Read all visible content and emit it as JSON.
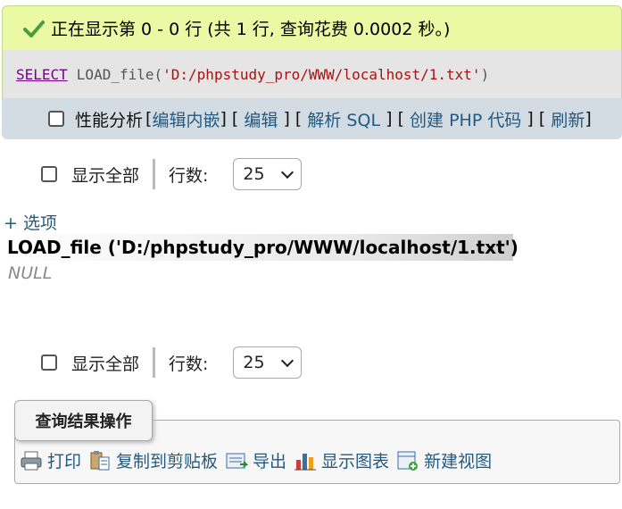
{
  "result_message": "正在显示第 0 - 0 行 (共 1 行, 查询花费 0.0002 秒。)",
  "sql": {
    "keyword": "SELECT",
    "function": "LOAD_file",
    "open": " (",
    "string": "'D:/phpstudy_pro/WWW/localhost/1.txt'",
    "close": ")"
  },
  "tools": {
    "profiling_label": "性能分析",
    "edit_inline": "编辑内嵌",
    "edit": "编辑",
    "explain_sql": "解析 SQL",
    "create_php": "创建 PHP 代码",
    "refresh": "刷新",
    "open_bracket": "[",
    "close_bracket": "]"
  },
  "navigation": {
    "show_all": "显示全部",
    "rows_label": "行数:",
    "rows_value": "25"
  },
  "options_link": "+ 选项",
  "result_table": {
    "column": "LOAD_file ('D:/phpstudy_pro/WWW/localhost/1.txt')",
    "value": "NULL"
  },
  "operations": {
    "legend": "查询结果操作",
    "items": [
      {
        "label": "打印",
        "icon": "print-icon"
      },
      {
        "label": "复制到剪贴板",
        "icon": "clipboard-icon"
      },
      {
        "label": "导出",
        "icon": "export-icon"
      },
      {
        "label": "显示图表",
        "icon": "chart-icon"
      },
      {
        "label": "新建视图",
        "icon": "create-view-icon"
      }
    ]
  },
  "colors": {
    "success_bg": "#ebf8a4",
    "link": "#235a81",
    "sql_keyword": "#770088",
    "sql_string": "#aa1111",
    "tools_bg": "#d3dce3"
  }
}
